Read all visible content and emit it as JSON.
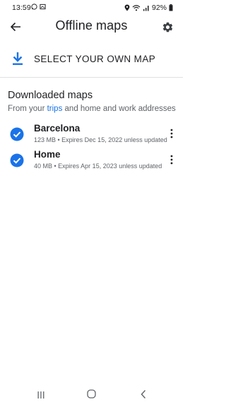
{
  "status_bar": {
    "time": "13:59",
    "battery": "92%",
    "icons": [
      "whatsapp-icon",
      "gallery-icon",
      "location-icon",
      "wifi-icon",
      "signal-icon",
      "battery-icon"
    ]
  },
  "app_bar": {
    "title": "Offline maps",
    "back_icon": "arrow-back-icon",
    "settings_icon": "gear-icon"
  },
  "select_map": {
    "label": "SELECT YOUR OWN MAP",
    "icon": "download-icon"
  },
  "downloaded": {
    "title": "Downloaded maps",
    "subtitle_prefix": "From your ",
    "subtitle_link": "trips",
    "subtitle_suffix": " and home and work addresses",
    "maps": [
      {
        "name": "Barcelona",
        "detail": "123 MB • Expires Dec 15, 2022 unless updated"
      },
      {
        "name": "Home",
        "detail": "40 MB • Expires Apr 15, 2023 unless updated"
      }
    ]
  },
  "colors": {
    "accent": "#1a73e8",
    "text_primary": "#202124",
    "text_secondary": "#5f6368",
    "divider": "#e0e0e0"
  }
}
